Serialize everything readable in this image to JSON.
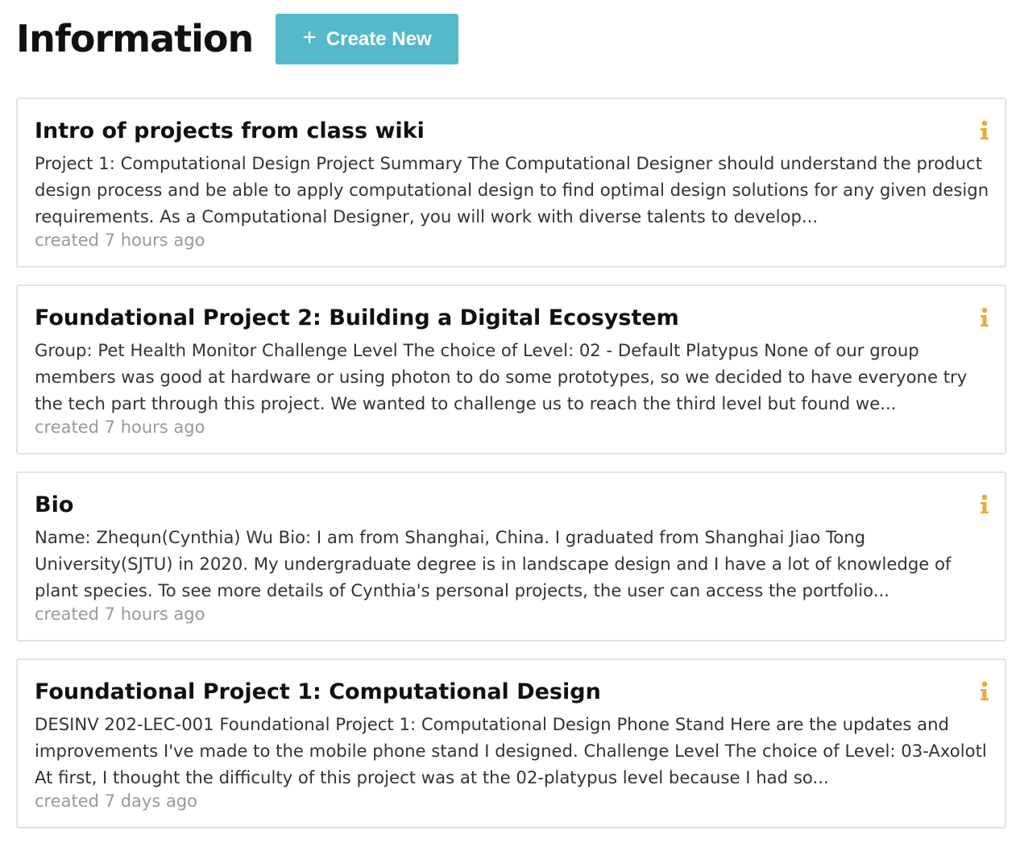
{
  "header": {
    "title": "Information",
    "create_button_label": "Create New"
  },
  "accent_color": "#55b8cb",
  "info_icon_color": "#e8a93d",
  "cards": [
    {
      "title": "Intro of projects from class wiki",
      "body": "Project 1: Computational Design Project Summary The Computational Designer should understand the product design process and be able to apply computational design to find optimal design solutions for any given design requirements. As a Computational Designer, you will work with diverse talents to develop...",
      "meta": "created 7 hours ago"
    },
    {
      "title": "Foundational Project 2: Building a Digital Ecosystem",
      "body": "Group: Pet Health Monitor Challenge Level The choice of Level: 02 - Default Platypus None of our group members was good at hardware or using photon to do some prototypes, so we decided to have everyone try the tech part through this project. We wanted to challenge us to reach the third level but found we...",
      "meta": "created 7 hours ago"
    },
    {
      "title": "Bio",
      "body": "Name: Zhequn(Cynthia) Wu Bio: I am from Shanghai, China. I graduated from Shanghai Jiao Tong University(SJTU) in 2020. My undergraduate degree is in landscape design and I have a lot of knowledge of plant species. To see more details of Cynthia's personal projects, the user can access the portfolio...",
      "meta": "created 7 hours ago"
    },
    {
      "title": "Foundational Project 1: Computational Design",
      "body": "DESINV 202-LEC-001 Foundational Project 1: Computational Design Phone Stand Here are the updates and improvements I've made to the mobile phone stand I designed. Challenge Level The choice of Level: 03-Axolotl At first, I thought the difficulty of this project was at the 02-platypus level because I had so...",
      "meta": "created 7 days ago"
    }
  ]
}
